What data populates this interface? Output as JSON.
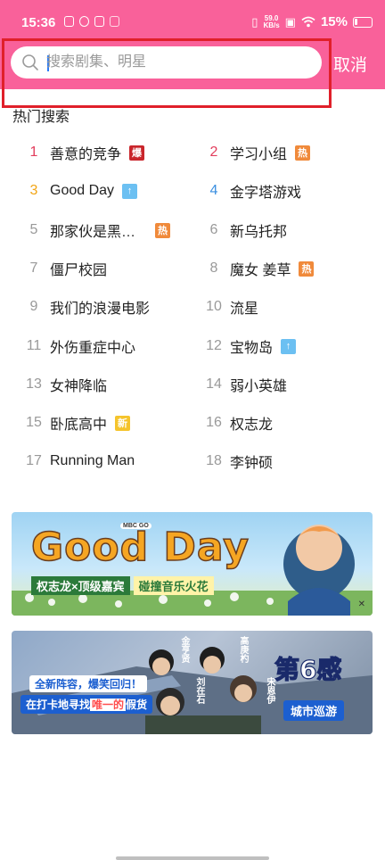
{
  "status_bar": {
    "time": "15:36",
    "net_speed_value": "59.0",
    "net_speed_unit": "KB/s",
    "battery": "15%"
  },
  "search": {
    "placeholder": "搜索剧集、明星",
    "value": ""
  },
  "header": {
    "cancel_label": "取消",
    "accent_color": "#f9619a"
  },
  "hot_search": {
    "title": "热门搜索",
    "items": [
      {
        "rank": "1",
        "text": "善意的竞争",
        "badge": "爆",
        "badge_color": "#c9252b",
        "rank_color": "#e23d5c"
      },
      {
        "rank": "2",
        "text": "学习小组",
        "badge": "热",
        "badge_color": "#f08a3b",
        "rank_color": "#e23d5c"
      },
      {
        "rank": "3",
        "text": "Good Day",
        "badge": "↑",
        "badge_color": "#6cc0f2",
        "rank_color": "#f2a515"
      },
      {
        "rank": "4",
        "text": "金字塔游戏",
        "badge": "",
        "badge_color": "",
        "rank_color": "#3b8fe0"
      },
      {
        "rank": "5",
        "text": "那家伙是黑…",
        "badge": "热",
        "badge_color": "#f08a3b",
        "rank_color": "#999999"
      },
      {
        "rank": "6",
        "text": "新乌托邦",
        "badge": "",
        "badge_color": "",
        "rank_color": "#999999"
      },
      {
        "rank": "7",
        "text": "僵尸校园",
        "badge": "",
        "badge_color": "",
        "rank_color": "#999999"
      },
      {
        "rank": "8",
        "text": "魔女 姜草",
        "badge": "热",
        "badge_color": "#f08a3b",
        "rank_color": "#999999"
      },
      {
        "rank": "9",
        "text": "我们的浪漫电影",
        "badge": "",
        "badge_color": "",
        "rank_color": "#999999"
      },
      {
        "rank": "10",
        "text": "流星",
        "badge": "",
        "badge_color": "",
        "rank_color": "#999999"
      },
      {
        "rank": "11",
        "text": "外伤重症中心",
        "badge": "",
        "badge_color": "",
        "rank_color": "#999999"
      },
      {
        "rank": "12",
        "text": "宝物岛",
        "badge": "↑",
        "badge_color": "#6cc0f2",
        "rank_color": "#999999"
      },
      {
        "rank": "13",
        "text": "女神降临",
        "badge": "",
        "badge_color": "",
        "rank_color": "#999999"
      },
      {
        "rank": "14",
        "text": "弱小英雄",
        "badge": "",
        "badge_color": "",
        "rank_color": "#999999"
      },
      {
        "rank": "15",
        "text": "卧底高中",
        "badge": "新",
        "badge_color": "#f5c42c",
        "rank_color": "#999999"
      },
      {
        "rank": "16",
        "text": "权志龙",
        "badge": "",
        "badge_color": "",
        "rank_color": "#999999"
      },
      {
        "rank": "17",
        "text": "Running Man",
        "badge": "",
        "badge_color": "",
        "rank_color": "#999999"
      },
      {
        "rank": "18",
        "text": "李钟硕",
        "badge": "",
        "badge_color": "",
        "rank_color": "#999999"
      }
    ]
  },
  "banners": [
    {
      "title": "Good Day",
      "small_logo": "MBC GO",
      "tagline_left": "权志龙×顶级嘉宾",
      "tagline_right": "碰撞音乐火花"
    },
    {
      "line1": "全新阵容，爆笑回归！",
      "line2_a": "在打卡地寻找",
      "line2_b": "唯一的",
      "line2_c": "假货",
      "names": [
        "金亨贤",
        "刘在石",
        "高庚杓",
        "宋恩伊"
      ],
      "logo": "第6感",
      "subtitle": "城市巡游"
    }
  ]
}
